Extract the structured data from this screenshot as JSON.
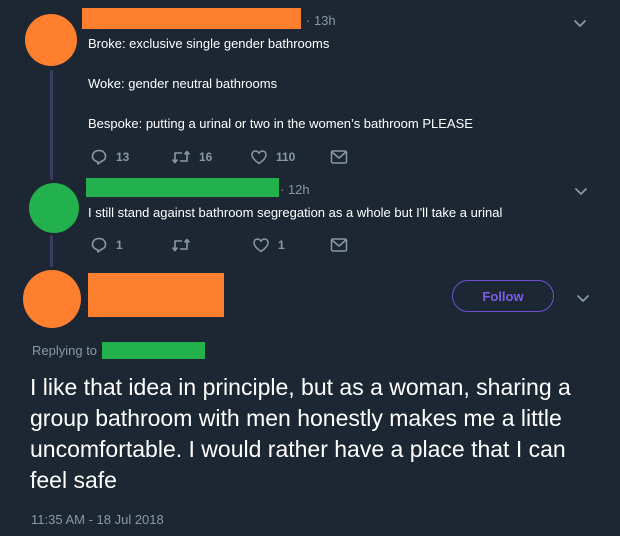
{
  "colors": {
    "background": "#1c2733",
    "thread_line": "#3d3a63",
    "avatar_orange": "#fe7f2d",
    "redact_orange": "#fe7f2d",
    "redact_green": "#22b14c",
    "follow_accent": "#7c5fe8",
    "muted": "#8899a6"
  },
  "tweet1": {
    "time": "· 13h",
    "lines": [
      "Broke: exclusive single gender bathrooms",
      "Woke: gender neutral bathrooms",
      "Bespoke: putting a urinal or two in the women’s bathroom PLEASE"
    ],
    "reply_count": "13",
    "retweet_count": "16",
    "like_count": "110"
  },
  "tweet2": {
    "time": "· 12h",
    "text": "I still stand against bathroom segregation as a whole but I'll take a urinal",
    "reply_count": "1",
    "retweet_count": "",
    "like_count": "1"
  },
  "main_tweet": {
    "follow_label": "Follow",
    "replying_to": "Replying to",
    "text": "I like that idea in principle, but as a woman, sharing a group bathroom with men honestly makes me a little uncomfortable. I would rather have a place that I can feel safe",
    "timestamp": "11:35 AM - 18 Jul 2018"
  },
  "icons": [
    "reply-icon",
    "retweet-icon",
    "like-icon",
    "message-icon",
    "chevron-down-icon"
  ]
}
